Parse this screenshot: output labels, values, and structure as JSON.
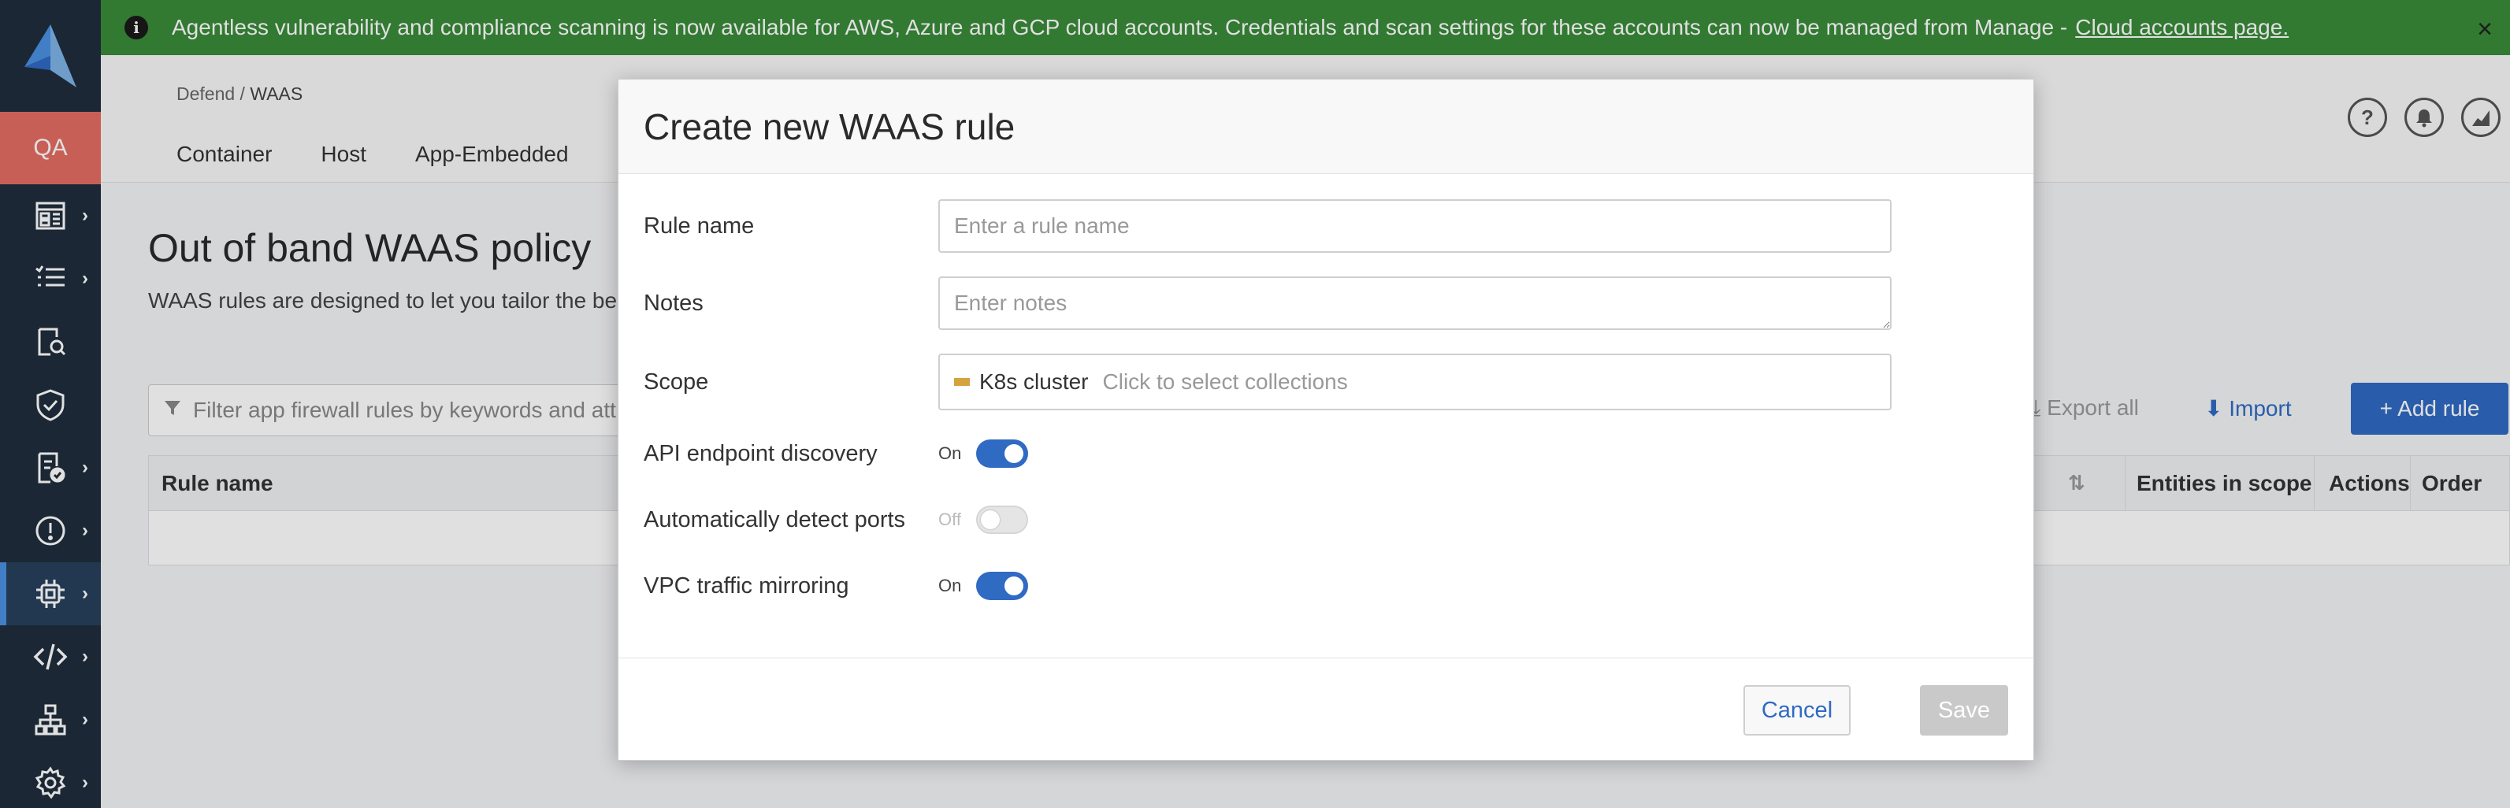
{
  "banner": {
    "text": "Agentless vulnerability and compliance scanning is now available for AWS, Azure and GCP cloud accounts. Credentials and scan settings for these accounts can now be managed from Manage - ",
    "link": "Cloud accounts page.",
    "info_icon": "info-icon",
    "close_icon": "close-icon"
  },
  "sidebar": {
    "badge": "QA",
    "items": [
      {
        "icon": "dashboard-icon"
      },
      {
        "icon": "list-icon"
      },
      {
        "icon": "search-report-icon"
      },
      {
        "icon": "shield-icon"
      },
      {
        "icon": "compliance-icon"
      },
      {
        "icon": "alert-icon"
      },
      {
        "icon": "chip-icon",
        "active": true
      },
      {
        "icon": "code-icon"
      },
      {
        "icon": "network-icon"
      },
      {
        "icon": "gear-icon"
      }
    ]
  },
  "header": {
    "breadcrumb_parent": "Defend",
    "breadcrumb_sep": " / ",
    "breadcrumb_current": "WAAS",
    "tabs": [
      "Container",
      "Host",
      "App-Embedded"
    ],
    "icons": [
      "help-icon",
      "bell-icon",
      "chart-icon"
    ]
  },
  "main": {
    "title": "Out of band WAAS policy",
    "description": "WAAS rules are designed to let you tailor the bes",
    "filter_placeholder": "Filter app firewall rules by keywords and att",
    "export_label": "Export all",
    "import_label": "Import",
    "add_rule_label": "+  Add rule",
    "table_headers": {
      "rule_name": "Rule name",
      "entities": "Entities in scope",
      "actions": "Actions",
      "order": "Order"
    }
  },
  "modal": {
    "title": "Create new WAAS rule",
    "rule_name_label": "Rule name",
    "rule_name_placeholder": "Enter a rule name",
    "notes_label": "Notes",
    "notes_placeholder": "Enter notes",
    "scope_label": "Scope",
    "scope_chip": "K8s cluster",
    "scope_placeholder": "Click to select collections",
    "scope_chip_color": "#d4a23e",
    "api_label": "API endpoint discovery",
    "api_state": "On",
    "ports_label": "Automatically detect ports",
    "ports_state": "Off",
    "vpc_label": "VPC traffic mirroring",
    "vpc_state": "On",
    "cancel_label": "Cancel",
    "save_label": "Save"
  },
  "colors": {
    "banner": "#3a8a3a",
    "sidebar": "#1f2d3d",
    "qa_badge": "#e46d63",
    "primary": "#2f6ac3"
  }
}
